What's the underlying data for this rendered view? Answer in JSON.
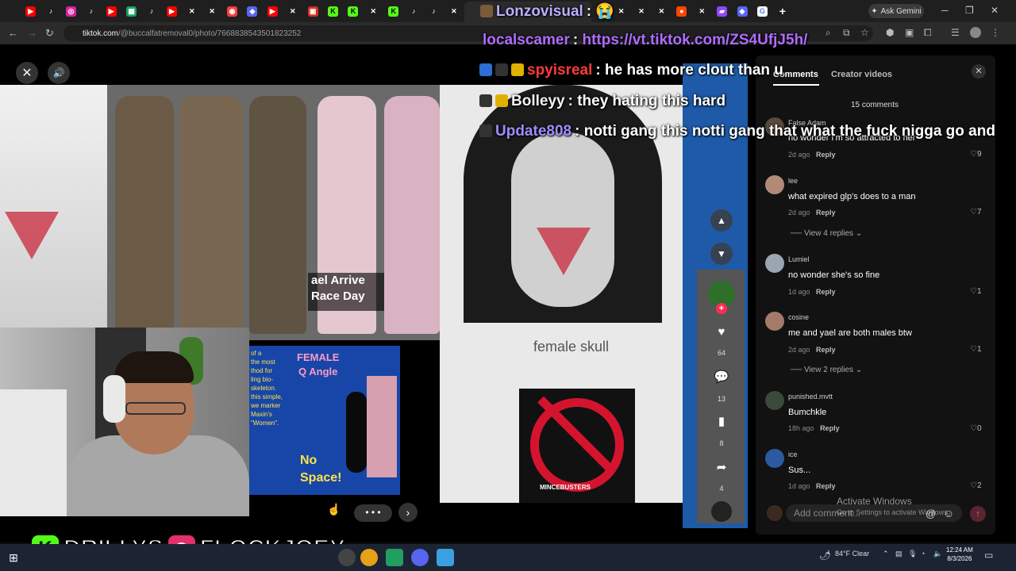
{
  "browser": {
    "gemini_label": "Ask Gemini",
    "url_host": "tiktok.com",
    "url_path": "/@buccalfatremoval0/photo/7668838543501823252"
  },
  "viewer": {
    "panel_caption": "ael Arrive\nRace Day",
    "qangle_title": "FEMALE\nQ Angle",
    "qangle_text": "of a\nthe most\nthod for\nling bio-\nskeleton.\nthis simple,\nwe marker\nMaxin's\n\"Women\".",
    "qangle_no": "No\nSpace!",
    "skull_label": "female skull",
    "no_label": "MINCEBUSTERS",
    "likes": "64",
    "comments": "13",
    "saves": "8",
    "shares": "4"
  },
  "comments_panel": {
    "tab_comments": "Comments",
    "tab_creator": "Creator videos",
    "count": "15 comments",
    "reply_label": "Reply",
    "items": [
      {
        "user": "False Adam",
        "text": "no wonder I'm so attracted to her",
        "age": "2d ago",
        "likes": "9"
      },
      {
        "user": "lee",
        "text": "what expired glp's does to a man",
        "age": "2d ago",
        "likes": "7"
      },
      {
        "user": "Lumiel",
        "text": "no wonder she's so fine",
        "age": "1d ago",
        "likes": "1"
      },
      {
        "user": "cosine",
        "text": "me and yael are both males btw",
        "age": "2d ago",
        "likes": "1"
      },
      {
        "user": "punished.mvtt",
        "text": "Bumchkle",
        "age": "18h ago",
        "likes": "0"
      },
      {
        "user": "ice",
        "text": "Sus...",
        "age": "1d ago",
        "likes": "2"
      }
    ],
    "view_replies": [
      "View 4 replies",
      "View 2 replies"
    ],
    "input_placeholder": "Add comment...",
    "activate_title": "Activate Windows",
    "activate_sub": "Go to Settings to activate Windows."
  },
  "chat": [
    {
      "user": "Lonzovisual",
      "text": "",
      "color": "#b9b0ff"
    },
    {
      "user": "localscamer",
      "text": "https://vt.tiktok.com/ZS4UfjJ5h/",
      "color": "#b06cff"
    },
    {
      "user": "spyisreal",
      "text": "he has more clout than u",
      "color": "#ff3b3b"
    },
    {
      "user": "Bolleyy",
      "text": "they hating this hard",
      "color": "#f2f2f2"
    },
    {
      "user": "Update808",
      "text": "notti gang this notti gang that what the fuck nigga go and",
      "color": "#9f8cff"
    }
  ],
  "socials": {
    "kick_name": "DRILLYS",
    "ig_name": "FLOCKJOEY",
    "kick_color": "#53fc18",
    "ig_color": "#e1306c"
  },
  "taskbar": {
    "weather": "84°F Clear",
    "time": "12:24 AM",
    "date": "8/3/2026"
  }
}
